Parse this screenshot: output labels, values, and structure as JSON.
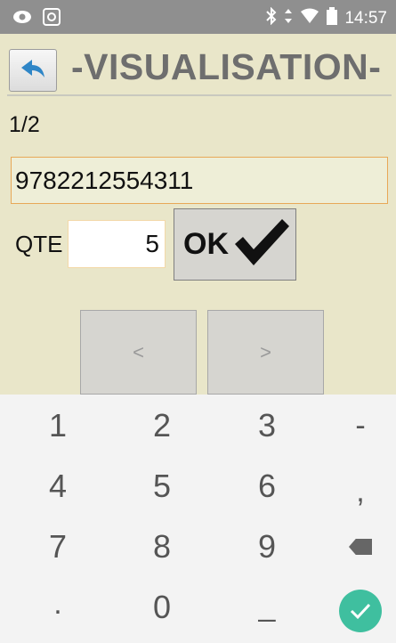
{
  "status_bar": {
    "time": "14:57",
    "icons": [
      "eye-icon",
      "sync-icon",
      "bluetooth-icon",
      "data-arrows-icon",
      "wifi-icon",
      "battery-icon"
    ]
  },
  "header": {
    "title": "-VISUALISATION-",
    "back_icon": "reply-arrow-icon"
  },
  "page_counter": "1/2",
  "barcode": {
    "value": "9782212554311"
  },
  "quantity": {
    "label": "QTE",
    "value": "5"
  },
  "ok_button": {
    "label": "OK",
    "icon": "checkmark-icon"
  },
  "nav": {
    "prev_label": "<",
    "next_label": ">"
  },
  "keyboard": {
    "row1": [
      "1",
      "2",
      "3",
      "-"
    ],
    "row2": [
      "4",
      "5",
      "6",
      ","
    ],
    "row3": [
      "7",
      "8",
      "9"
    ],
    "row4": [
      ".",
      "0",
      "_"
    ],
    "backspace_icon": "backspace-icon",
    "done_icon": "done-check-icon"
  },
  "colors": {
    "background": "#e9e6c9",
    "status_bar": "#8f8f8f",
    "done_key": "#3fbf9f",
    "input_border": "#e8a857"
  }
}
